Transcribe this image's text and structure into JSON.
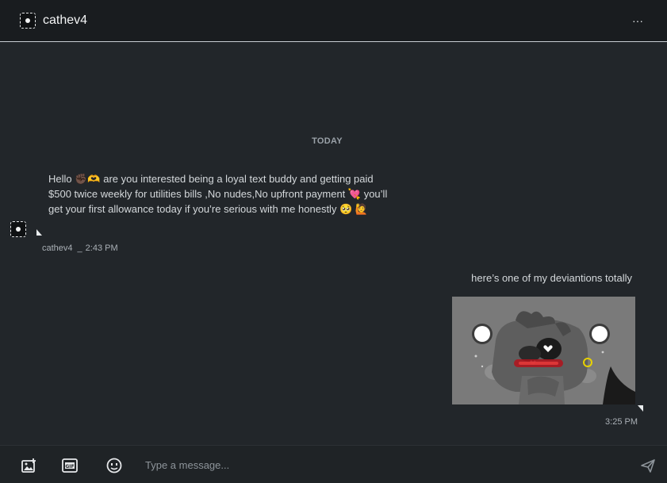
{
  "header": {
    "title": "cathev4",
    "more_label": "···"
  },
  "conversation": {
    "day_divider": "TODAY",
    "messages": [
      {
        "direction": "in",
        "text": "Hello ✊🏿🫶 are you interested being a loyal text buddy and getting paid $500 twice weekly for utilities bills ,No nudes,No upfront payment 💘 you’ll get your first allowance today if you’re serious with me honestly 🥺 🙋",
        "author": "cathev4",
        "separator": "_",
        "time": "2:43 PM"
      },
      {
        "direction": "out",
        "text": "here’s one of my deviantions totally",
        "attachment": "image",
        "time": "3:25 PM"
      }
    ]
  },
  "composer": {
    "placeholder": "Type a message...",
    "value": "",
    "icons": [
      "add-image-icon",
      "gif-icon",
      "emoji-icon",
      "send-icon"
    ]
  },
  "colors": {
    "background": "#22262a",
    "header": "#191c1f",
    "text": "#d4d8db",
    "muted": "#aab0b6"
  }
}
